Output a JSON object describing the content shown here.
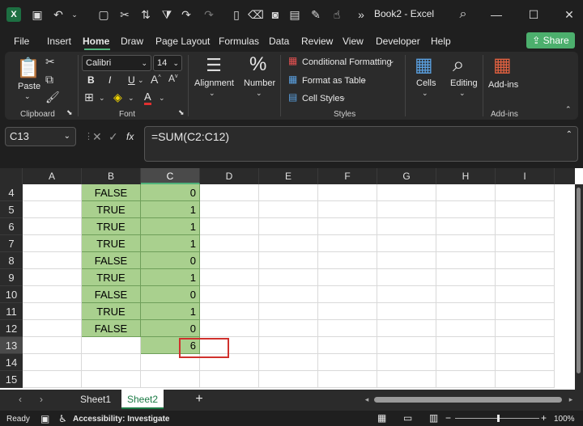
{
  "titlebar": {
    "title": "Book2  -  Excel",
    "logo": "X"
  },
  "menu": {
    "tabs": [
      "File",
      "Insert",
      "Home",
      "Draw",
      "Page Layout",
      "Formulas",
      "Data",
      "Review",
      "View",
      "Developer",
      "Help"
    ],
    "active": "Home",
    "share_label": "Share"
  },
  "ribbon": {
    "clipboard": {
      "paste_label": "Paste",
      "group_label": "Clipboard"
    },
    "font": {
      "font_name": "Calibri",
      "font_size": "14",
      "bold": "B",
      "italic": "I",
      "underline": "U",
      "font_color_glyph": "A",
      "group_label": "Font"
    },
    "alignment": {
      "label": "Alignment"
    },
    "number": {
      "label": "Number",
      "glyph": "%"
    },
    "styles": {
      "conditional_formatting": "Conditional Formatting",
      "format_as_table": "Format as Table",
      "cell_styles": "Cell Styles",
      "group_label": "Styles"
    },
    "cells": {
      "label": "Cells"
    },
    "editing": {
      "label": "Editing"
    },
    "addins": {
      "label": "Add-ins",
      "group_label": "Add-ins"
    }
  },
  "formula_bar": {
    "name_box": "C13",
    "formula": "=SUM(C2:C12)",
    "fx": "fx"
  },
  "grid": {
    "columns": [
      "A",
      "B",
      "C",
      "D",
      "E",
      "F",
      "G",
      "H",
      "I"
    ],
    "selected_column": "C",
    "rows": [
      {
        "num": "4",
        "b": "FALSE",
        "c": "0"
      },
      {
        "num": "5",
        "b": "TRUE",
        "c": "1"
      },
      {
        "num": "6",
        "b": "TRUE",
        "c": "1"
      },
      {
        "num": "7",
        "b": "TRUE",
        "c": "1"
      },
      {
        "num": "8",
        "b": "FALSE",
        "c": "0"
      },
      {
        "num": "9",
        "b": "TRUE",
        "c": "1"
      },
      {
        "num": "10",
        "b": "FALSE",
        "c": "0"
      },
      {
        "num": "11",
        "b": "TRUE",
        "c": "1"
      },
      {
        "num": "12",
        "b": "FALSE",
        "c": "0"
      },
      {
        "num": "13",
        "b": "",
        "c": "6"
      },
      {
        "num": "14",
        "b": "",
        "c": ""
      },
      {
        "num": "15",
        "b": "",
        "c": ""
      }
    ],
    "selected_row": "13"
  },
  "sheets": {
    "tabs": [
      "Sheet1",
      "Sheet2"
    ],
    "active": "Sheet2",
    "add_glyph": "+"
  },
  "status": {
    "ready": "Ready",
    "accessibility": "Accessibility: Investigate",
    "zoom": "100%"
  },
  "colors": {
    "accent": "#4fb27a",
    "cell_fill": "#a9d08e",
    "highlight_box": "#d0312d"
  }
}
